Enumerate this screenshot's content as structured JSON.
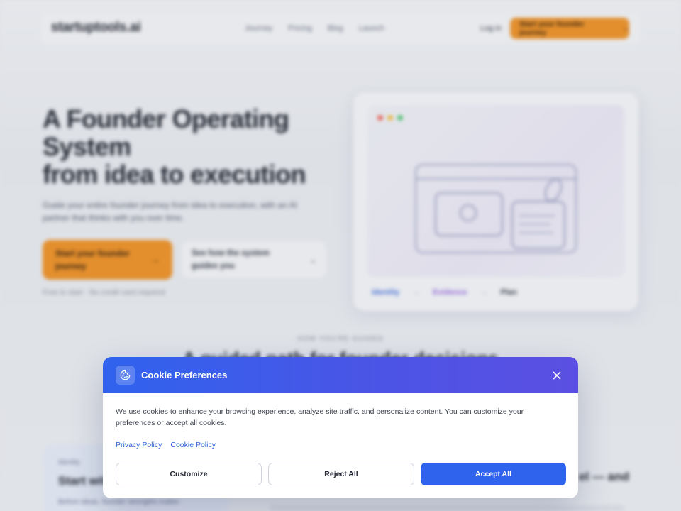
{
  "background": {
    "logo": "startuptools.ai",
    "nav_links": [
      "Journey",
      "Pricing",
      "Blog",
      "Launch"
    ],
    "login": "Log in",
    "nav_cta": "Start your founder journey",
    "hero_title_line1": "A Founder Operating System",
    "hero_title_line2": "from idea to execution",
    "hero_subtitle": "Guide your entire founder journey from idea to execution, with an AI partner that thinks with you over time.",
    "hero_cta_primary": "Start your founder journey",
    "hero_cta_secondary": "See how the system guides you",
    "hero_note": "Free to start · No credit card required",
    "mock_steps": [
      "Identity",
      "→",
      "Evidence",
      "→",
      "Plan"
    ],
    "section_eyebrow": "HOW YOU'RE GUIDED",
    "section_title": "A guided path for founder decisions",
    "card_label": "Identity",
    "card_title": "Start with who you are",
    "card_text": "Before ideas, founder strengths matter.",
    "card_right_title": "el — and"
  },
  "cookie_modal": {
    "title": "Cookie Preferences",
    "description": "We use cookies to enhance your browsing experience, analyze site traffic, and personalize content. You can customize your preferences or accept all cookies.",
    "privacy_link": "Privacy Policy",
    "cookie_link": "Cookie Policy",
    "customize_label": "Customize",
    "reject_label": "Reject All",
    "accept_label": "Accept All",
    "header_gradient": [
      "#2f63ee",
      "#5b4fe2"
    ],
    "accent": "#2f63ee",
    "icon": "cookie-icon",
    "close_icon": "close-icon"
  },
  "colors": {
    "brand_orange": "#f0952c",
    "link_blue": "#2f63d8"
  }
}
